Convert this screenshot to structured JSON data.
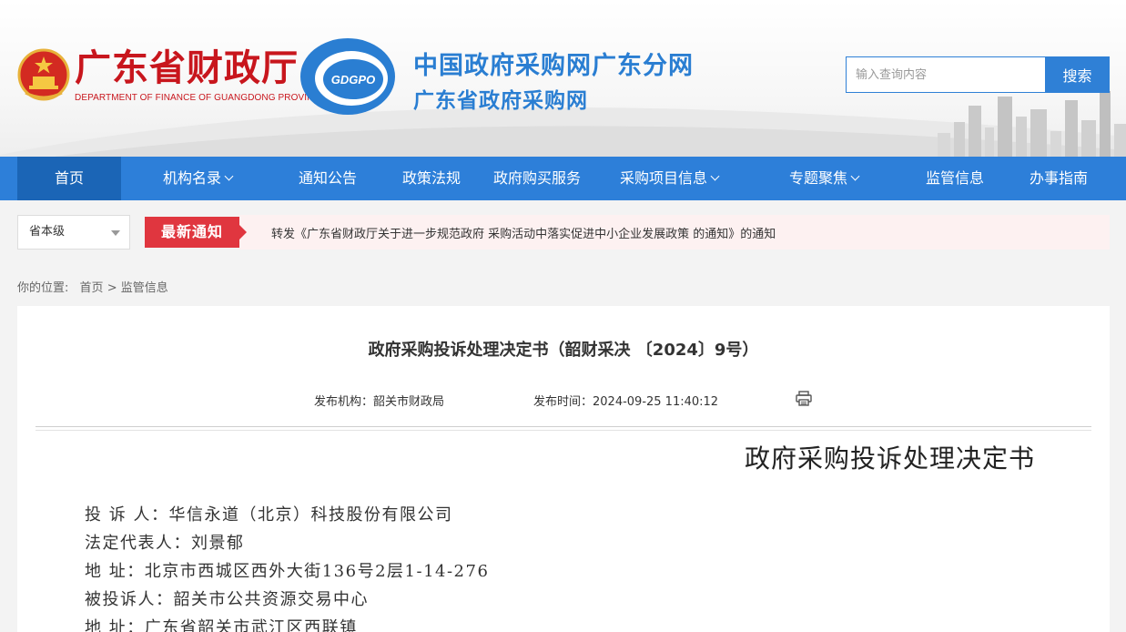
{
  "header": {
    "dept_name_cn": "广东省财政厅",
    "dept_name_en": "DEPARTMENT OF FINANCE OF GUANGDONG PROVINCE",
    "logo_text": "GDGPO",
    "site_title_1": "中国政府采购网广东分网",
    "site_title_2": "广东省政府采购网",
    "search_placeholder": "输入查询内容",
    "search_button": "搜索"
  },
  "nav": {
    "items": [
      {
        "label": "首页",
        "active": true
      },
      {
        "label": "机构名录",
        "dropdown": true
      },
      {
        "label": "通知公告"
      },
      {
        "label": "政策法规"
      },
      {
        "label": "政府购买服务"
      },
      {
        "label": "采购项目信息",
        "dropdown": true
      },
      {
        "label": "专题聚焦",
        "dropdown": true
      },
      {
        "label": "监管信息"
      },
      {
        "label": "办事指南"
      }
    ]
  },
  "notice": {
    "region_selected": "省本级",
    "label": "最新通知",
    "text": "转发《广东省财政厅关于进一步规范政府 采购活动中落实促进中小企业发展政策 的通知》的通知"
  },
  "breadcrumb": {
    "prefix": "你的位置:",
    "home": "首页",
    "sep": ">",
    "current": "监管信息"
  },
  "article": {
    "title": "政府采购投诉处理决定书（韶财采决 〔2024〕9号）",
    "publisher": "发布机构：韶关市财政局",
    "publish_time": "发布时间：2024-09-25 11:40:12",
    "doc_heading": "政府采购投诉处理决定书",
    "lines": [
      "投 诉 人：华信永道（北京）科技股份有限公司",
      "法定代表人：刘景郁",
      "地 址：北京市西城区西外大街136号2层1-14-276",
      "被投诉人：韶关市公共资源交易中心",
      "地 址：广东省韶关市武江区西联镇"
    ]
  },
  "colors": {
    "brand_red": "#c8161d",
    "brand_blue": "#2a7ed2",
    "nav_blue": "#2d7fd9",
    "nav_active": "#1b65b6",
    "notice_red": "#e0363f"
  }
}
